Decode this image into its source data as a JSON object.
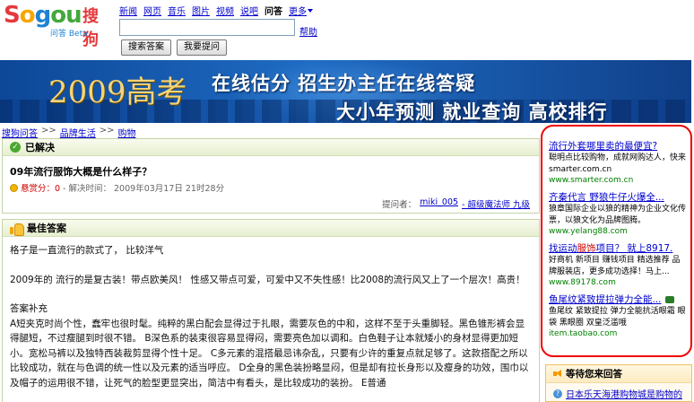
{
  "logo": {
    "brand_s": "S",
    "brand_o": "o",
    "brand_g": "g",
    "brand_rest": "ou",
    "cn": "搜狗",
    "sub": "问答 Beta"
  },
  "nav": {
    "items": [
      "新闻",
      "网页",
      "音乐",
      "图片",
      "视频",
      "说吧"
    ],
    "current": "问答",
    "more": "更多"
  },
  "search": {
    "value": "",
    "help": "帮助",
    "search_btn": "搜索答案",
    "ask_btn": "我要提问"
  },
  "banner": {
    "year": "2009高考",
    "line1": "在线估分 招生办主任在线答疑",
    "line2": "大小年预测 就业查询 高校排行"
  },
  "breadcrumb": {
    "items": [
      "搜狗问答",
      "品牌生活",
      "购物"
    ],
    "sep": ">>"
  },
  "question": {
    "status": "已解决",
    "title": "09年流行服饰大概是什么样子？",
    "reward_label": "悬赏分：0",
    "time": "- 解决时间： 2009年03月17日 21时28分",
    "asker_label": "提问者：",
    "asker": "miki_005",
    "asker_rank": "- 超级魔法师 九级"
  },
  "best_answer": {
    "title": "最佳答案",
    "p1": "格子是一直流行的款式了， 比较洋气",
    "p2": "2009年的 流行的是复古装！带点欧美风！ 性感又带点可爱，可爱中又不失性感！比2008的流行风又上了一个层次！高贵！",
    "p3_head": "答案补充",
    "p3": "A短夹克时尚个性，蠢牢也很时髦。纯粹的黑白配会显得过于扎眼，需要灰色的中和，这样不至于头重脚轻。黑色锥形裤会显得腿短，不过瘦腿到时很不错。 B深色系的装束很容易显得闷，需要亮色加以调和。白色鞋子让本就矮小的身材显得更加短小。宽松马裤以及独特西装裁剪显得个性十足。 C多元素的混搭最忌讳杂乱，只要有少许的重复点就足够了。这款搭配之所以比较成功，就在与色调的统一性以及元素的适当呼应。 D全身的黑色装扮略显闷，但是却有拉长身形以及瘦身的功效，围巾以及帽子的运用很不错，让死气的脸型更显突出，简洁中有看头，是比较成功的装扮。 E普通"
  },
  "ads": [
    {
      "title": "流行外套哪里卖的最便宜?",
      "desc": "聪明点比较购物，成就网购达人，快来smarter.com.cn",
      "url": "www.smarter.com.cn"
    },
    {
      "title_pre": "齐秦代言 野狼牛仔火爆全...",
      "desc": "狼章国际企业以狼的精神为企业文化传票，以狼文化为品牌图腾。",
      "url": "www.yelang88.com"
    },
    {
      "title_pre": "找运动",
      "title_kw": "服饰",
      "title_post": "项目？ 就上8917.",
      "desc": "好商机 新项目 赚钱项目 精选推荐 品牌服装店，更多成功选择！马上...",
      "url": "www.89178.com"
    },
    {
      "title": "鱼尾纹紧致提拉弹力全能...",
      "desc": "鱼尾纹 紧致提拉 弹力全能抗活眼霜 眼袋 黑眼圈 双皇泛滥哦",
      "url": "item.taobao.com"
    }
  ],
  "waiting": {
    "title": "等待您来回答",
    "item": "日本乐天海港购物城是购物的"
  }
}
